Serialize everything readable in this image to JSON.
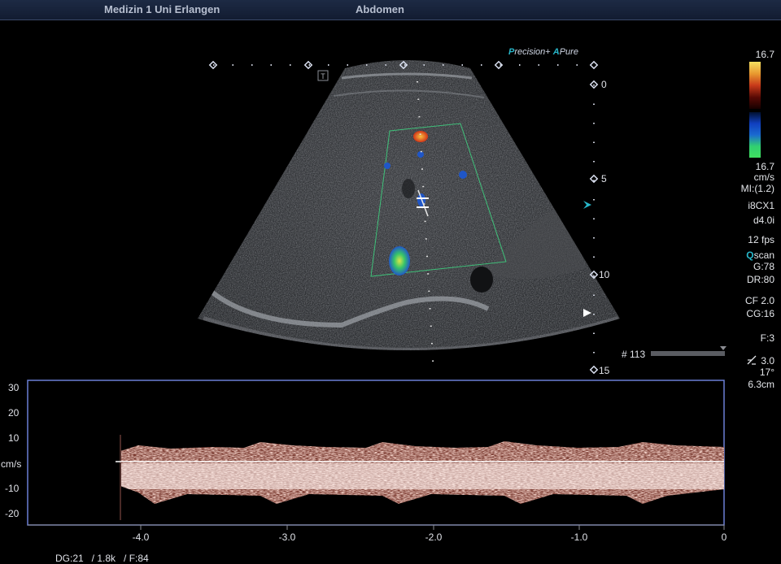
{
  "header": {
    "institution": "Medizin 1 Uni Erlangen",
    "preset": "Abdomen"
  },
  "brand": {
    "p_letter": "P",
    "precision": "recision",
    "plus": "+",
    "a_letter": "A",
    "pure": "Pure"
  },
  "depth_scale": {
    "labels": [
      "0",
      "5",
      "10",
      "15"
    ]
  },
  "color_bar": {
    "max": "16.7",
    "min": "16.7",
    "unit": "cm/s"
  },
  "params": {
    "mi": "MI:(1.2)",
    "transducer": "i8CX1",
    "harmonic": "d4.0i",
    "fps": "12 fps",
    "qscan_q": "Q",
    "qscan_rest": "scan",
    "gain": "G:78",
    "dynamic_range": "DR:80",
    "cf": "CF 2.0",
    "cg": "CG:16",
    "focus": "F:3",
    "gate": "3.0",
    "angle": "17°",
    "depth": "6.3cm"
  },
  "frame": {
    "label": "# 113"
  },
  "doppler": {
    "unit_label": "cm/s",
    "y_ticks": [
      "30",
      "20",
      "10",
      "-10",
      "-20"
    ],
    "x_ticks": [
      "-4.0",
      "-3.0",
      "-2.0",
      "-1.0",
      "0"
    ],
    "bottom_text": "DG:21   / 1.8k   / F:84"
  },
  "colors": {
    "frame_border": "#6a7fd6",
    "color_roi": "#3fc17a",
    "accent": "#27b6c9"
  }
}
